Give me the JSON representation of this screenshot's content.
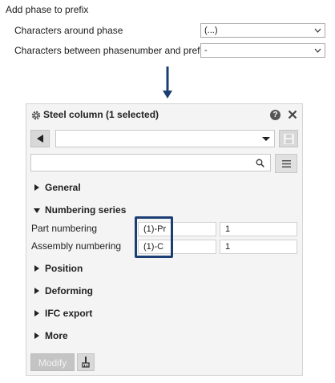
{
  "top": {
    "title": "Add phase to prefix",
    "row1": {
      "label": "Characters around phase",
      "value": "(...)"
    },
    "row2": {
      "label": "Characters between phasenumber and prefix",
      "value": "-"
    }
  },
  "panel": {
    "title": "Steel column (1 selected)",
    "help_label": "?",
    "sections": {
      "general": "General",
      "numbering": "Numbering series",
      "position": "Position",
      "deforming": "Deforming",
      "ifc": "IFC export",
      "more": "More"
    },
    "numbering": {
      "part_label": "Part numbering",
      "part_prefix": "(1)-Pr",
      "part_start": "1",
      "assembly_label": "Assembly numbering",
      "assembly_prefix": "(1)-C",
      "assembly_start": "1"
    },
    "modify_label": "Modify"
  },
  "colors": {
    "highlight_border": "#1c3f73",
    "arrow": "#1c3f73"
  },
  "icons": {
    "settings": "gear-icon",
    "help": "help-icon",
    "close": "close-icon",
    "back": "back-arrow-icon",
    "save": "save-icon",
    "search": "search-icon",
    "list": "list-icon",
    "pick": "pick-icon"
  }
}
